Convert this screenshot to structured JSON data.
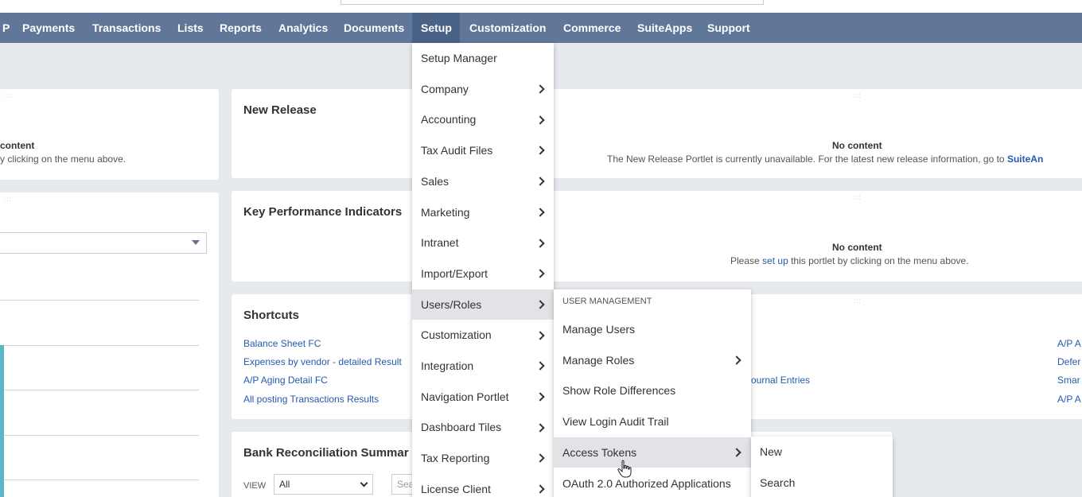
{
  "nav": {
    "items": [
      {
        "label": "P"
      },
      {
        "label": "Payments"
      },
      {
        "label": "Transactions"
      },
      {
        "label": "Lists"
      },
      {
        "label": "Reports"
      },
      {
        "label": "Analytics"
      },
      {
        "label": "Documents"
      },
      {
        "label": "Setup",
        "active": true
      },
      {
        "label": "Customization"
      },
      {
        "label": "Commerce"
      },
      {
        "label": "SuiteApps"
      },
      {
        "label": "Support"
      }
    ]
  },
  "left_portlet": {
    "no_content_title": "content",
    "no_content_text": "y clicking on the menu above."
  },
  "new_release": {
    "title": "New Release",
    "no_content_title": "No content",
    "no_content_text": "The New Release Portlet is currently unavailable. For the latest new release information, go to",
    "link": "SuiteAn"
  },
  "kpi": {
    "title": "Key Performance Indicators",
    "no_content_title": "No content",
    "text_before": "Please",
    "link": "set up",
    "text_after": "this portlet by clicking on the menu above."
  },
  "shortcuts": {
    "title": "Shortcuts",
    "links": [
      "Balance Sheet FC",
      "Expenses by vendor - detailed Result",
      "A/P Aging Detail FC",
      "All posting Transactions Results"
    ],
    "middle_link": "ournal Entries",
    "right_links": [
      "A/P A",
      "Defer",
      "Smar",
      "A/P A"
    ]
  },
  "bank_rec": {
    "title": "Bank Reconciliation Summar",
    "view_label": "VIEW",
    "view_value": "All",
    "search_placeholder": "Sea"
  },
  "setup_menu": {
    "items": [
      {
        "label": "Setup Manager",
        "submenu": false
      },
      {
        "label": "Company",
        "submenu": true
      },
      {
        "label": "Accounting",
        "submenu": true
      },
      {
        "label": "Tax Audit Files",
        "submenu": true
      },
      {
        "label": "Sales",
        "submenu": true
      },
      {
        "label": "Marketing",
        "submenu": true
      },
      {
        "label": "Intranet",
        "submenu": true
      },
      {
        "label": "Import/Export",
        "submenu": true
      },
      {
        "label": "Users/Roles",
        "submenu": true,
        "highlighted": true
      },
      {
        "label": "Customization",
        "submenu": true
      },
      {
        "label": "Integration",
        "submenu": true
      },
      {
        "label": "Navigation Portlet",
        "submenu": true
      },
      {
        "label": "Dashboard Tiles",
        "submenu": true
      },
      {
        "label": "Tax Reporting",
        "submenu": true
      },
      {
        "label": "License Client",
        "submenu": true
      }
    ]
  },
  "users_roles_menu": {
    "header": "USER MANAGEMENT",
    "items": [
      {
        "label": "Manage Users",
        "submenu": false
      },
      {
        "label": "Manage Roles",
        "submenu": true
      },
      {
        "label": "Show Role Differences",
        "submenu": false
      },
      {
        "label": "View Login Audit Trail",
        "submenu": false
      },
      {
        "label": "Access Tokens",
        "submenu": true,
        "highlighted": true
      },
      {
        "label": "OAuth 2.0 Authorized Applications",
        "submenu": false
      }
    ]
  },
  "access_tokens_menu": {
    "items": [
      {
        "label": "New"
      },
      {
        "label": "Search"
      }
    ]
  },
  "colors": {
    "navbar": "#607799",
    "navbar_active": "#4a6286",
    "link": "#255ab0",
    "menu_highlight": "#e1e3e6",
    "accent_teal": "#5ab8c8"
  }
}
